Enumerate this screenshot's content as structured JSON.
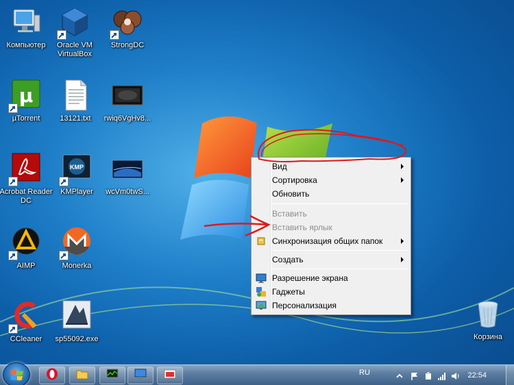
{
  "desktop_icons": [
    {
      "label": "Компьютер",
      "icon": "computer-icon",
      "shortcut": false
    },
    {
      "label": "Oracle VM VirtualBox",
      "icon": "virtualbox-icon",
      "shortcut": true
    },
    {
      "label": "StrongDC",
      "icon": "strongdc-icon",
      "shortcut": true
    },
    {
      "label": "µTorrent",
      "icon": "utorrent-icon",
      "shortcut": true
    },
    {
      "label": "13121.txt",
      "icon": "text-file-icon",
      "shortcut": false
    },
    {
      "label": "rwiq6VgHv8...",
      "icon": "image-file-icon",
      "shortcut": false
    },
    {
      "label": "Acrobat Reader DC",
      "icon": "acrobat-icon",
      "shortcut": true
    },
    {
      "label": "KMPlayer",
      "icon": "kmplayer-icon",
      "shortcut": true
    },
    {
      "label": "wcVm0twS...",
      "icon": "image-file-icon",
      "shortcut": false
    },
    {
      "label": "AIMP",
      "icon": "aimp-icon",
      "shortcut": true
    },
    {
      "label": "Monerka",
      "icon": "monero-icon",
      "shortcut": true
    },
    {
      "label": "CCleaner",
      "icon": "ccleaner-icon",
      "shortcut": true
    },
    {
      "label": "sp55092.exe",
      "icon": "exe-file-icon",
      "shortcut": false
    },
    {
      "label": "Корзина",
      "icon": "recycle-bin-icon",
      "shortcut": false
    }
  ],
  "context_menu": {
    "items": [
      {
        "label": "Вид",
        "submenu": true,
        "disabled": false
      },
      {
        "label": "Сортировка",
        "submenu": true,
        "disabled": false
      },
      {
        "label": "Обновить",
        "submenu": false,
        "disabled": false
      },
      {
        "label": "Вставить",
        "submenu": false,
        "disabled": true
      },
      {
        "label": "Вставить ярлык",
        "submenu": false,
        "disabled": true
      },
      {
        "label": "Синхронизация общих папок",
        "submenu": true,
        "disabled": false,
        "icon": "sync-folder-icon"
      },
      {
        "label": "Создать",
        "submenu": true,
        "disabled": false
      },
      {
        "label": "Разрешение экрана",
        "submenu": false,
        "disabled": false,
        "icon": "screen-resolution-icon"
      },
      {
        "label": "Гаджеты",
        "submenu": false,
        "disabled": false,
        "icon": "gadgets-icon"
      },
      {
        "label": "Персонализация",
        "submenu": false,
        "disabled": false,
        "icon": "personalization-icon"
      }
    ]
  },
  "taskbar": {
    "pinned": [
      "opera-icon",
      "explorer-icon",
      "task-manager-icon",
      "remote-desktop-icon",
      "screen-capture-icon"
    ],
    "language": "RU",
    "clock": "22:54"
  },
  "colors": {
    "annotation": "#e01818",
    "menu_bg": "#f0f0f0",
    "disabled_text": "#8d8d8d"
  }
}
